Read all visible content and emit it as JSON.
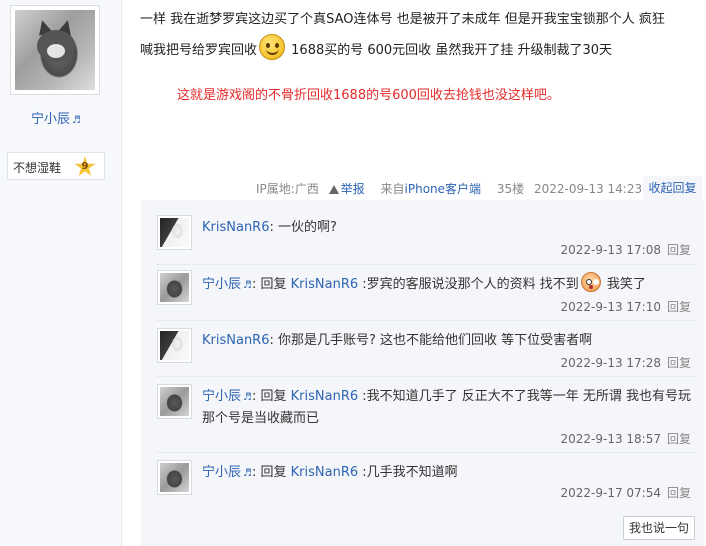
{
  "user": {
    "name": "宁小辰",
    "badge_label": "不想湿鞋",
    "level": "9"
  },
  "post": {
    "line1": "一样 我在逝梦罗宾这边买了个真SAO连体号 也是被开了未成年 但是开我宝宝锁那个人 疯狂",
    "line2_a": "喊我把号给罗宾回收",
    "line2_b": "1688买的号 600元回收 虽然我开了挂 升级制裁了30天",
    "red_text": "这就是游戏阁的不骨折回收1688的号600回收去抢钱也没这样吧。"
  },
  "meta": {
    "ip": "IP属地:广西",
    "report": "举报",
    "client": "来自iPhone客户端",
    "floor": "35楼",
    "time": "2022-09-13 14:23",
    "collapse": "收起回复"
  },
  "replies": [
    {
      "user": "KrisNanR6",
      "colon": ": ",
      "text": "一伙的啊?",
      "time": "2022-9-13 17:08",
      "reply_label": "回复"
    },
    {
      "user": "宁小辰",
      "colon": ": 回复 ",
      "target": "KrisNanR6",
      "text": " :罗宾的客服说没那个人的资料 找不到",
      "text_after": " 我笑了",
      "time": "2022-9-13 17:10",
      "reply_label": "回复"
    },
    {
      "user": "KrisNanR6",
      "colon": ": ",
      "text": "你那是几手账号?  这也不能给他们回收 等下位受害者啊",
      "time": "2022-9-13 17:28",
      "reply_label": "回复"
    },
    {
      "user": "宁小辰",
      "colon": ": 回复 ",
      "target": "KrisNanR6",
      "text": " :我不知道几手了 反正大不了我等一年 无所谓 我也有号玩 那个号是当收藏而已",
      "time": "2022-9-13 18:57",
      "reply_label": "回复"
    },
    {
      "user": "宁小辰",
      "colon": ": 回复 ",
      "target": "KrisNanR6",
      "text": " :几手我不知道啊",
      "time": "2022-9-17 07:54",
      "reply_label": "回复"
    }
  ],
  "say_button": "我也说一句"
}
